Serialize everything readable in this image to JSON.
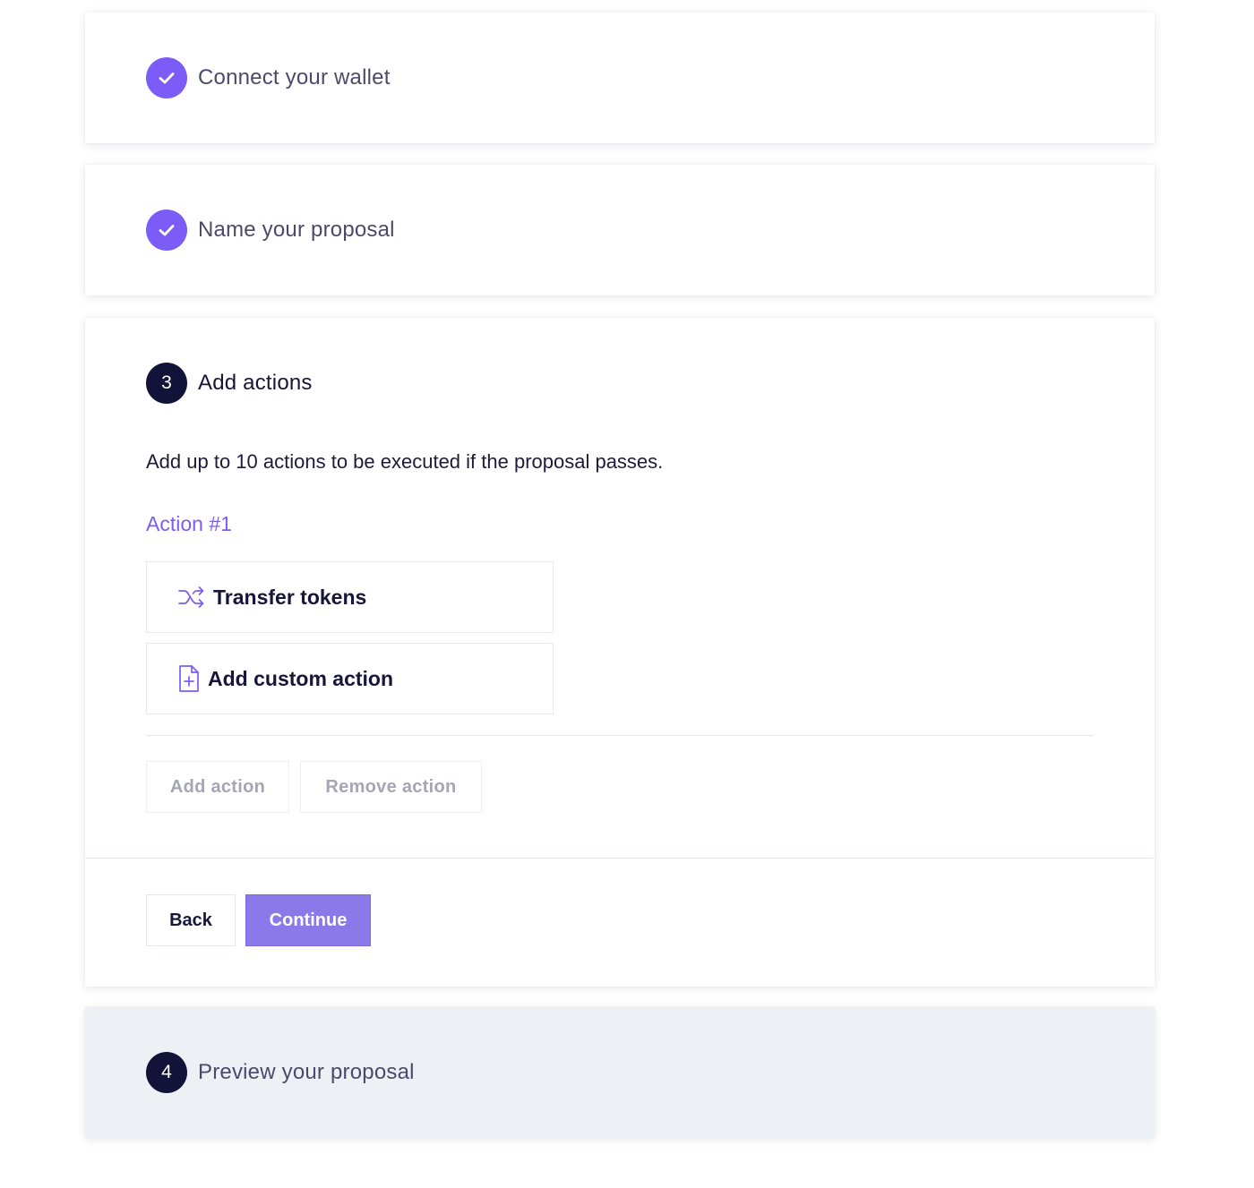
{
  "steps": [
    {
      "title": "Connect your wallet",
      "status": "done"
    },
    {
      "title": "Name your proposal",
      "status": "done"
    },
    {
      "number": "3",
      "title": "Add actions",
      "status": "active"
    },
    {
      "number": "4",
      "title": "Preview your proposal",
      "status": "upcoming"
    }
  ],
  "add_actions": {
    "description": "Add up to 10 actions to be executed if the proposal passes.",
    "action_label": "Action #1",
    "options": [
      {
        "label": "Transfer tokens",
        "icon": "shuffle-arrows-icon"
      },
      {
        "label": "Add custom action",
        "icon": "file-plus-icon"
      }
    ],
    "add_action_label": "Add action",
    "remove_action_label": "Remove action",
    "back_label": "Back",
    "continue_label": "Continue"
  },
  "colors": {
    "accent": "#7b5cf6",
    "step_number_bg": "#13133a",
    "continue_bg": "#8b78e9",
    "upcoming_card_bg": "#edf1f6"
  }
}
